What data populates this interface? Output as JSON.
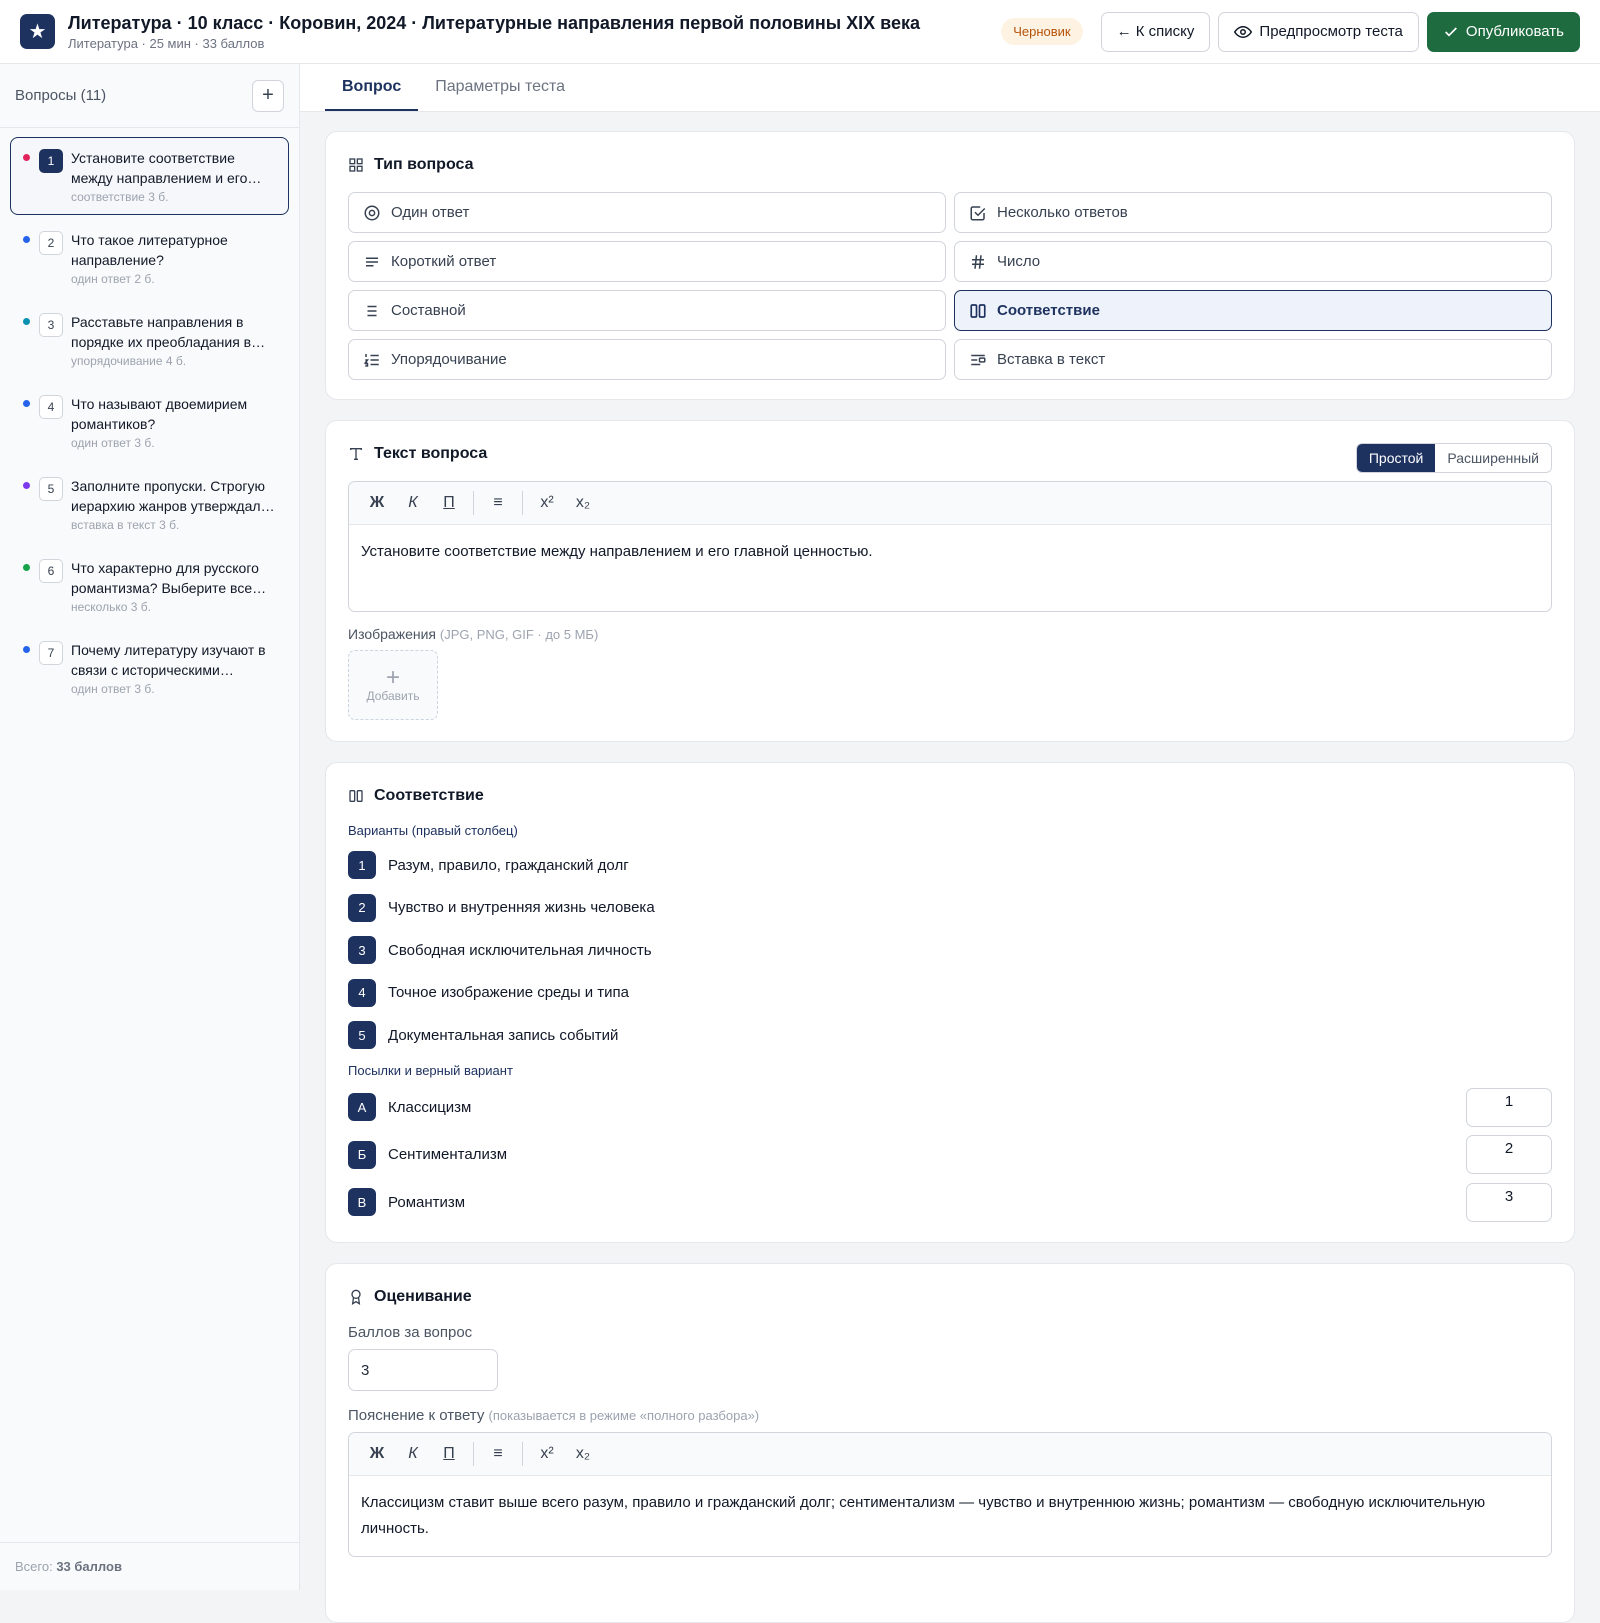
{
  "header": {
    "title": "Литература · 10 класс · Коровин, 2024 · Литературные направления первой половины XIX века",
    "subtitle": "Литература · 25 мин · 33 баллов",
    "status": "Черновик",
    "back_label": "← К списку",
    "preview_label": "Предпросмотр теста",
    "publish_label": "Опубликовать"
  },
  "sidebar": {
    "title": "Вопросы (11)",
    "add_label": "+",
    "total_prefix": "Всего:",
    "total_value": "33 баллов",
    "questions": [
      {
        "num": "1",
        "text": "Установите соответствие между направлением и его главной ценностью.",
        "type": "соответствие",
        "points": "3 б.",
        "color": "#e0245e"
      },
      {
        "num": "2",
        "text": "Что такое литературное направление?",
        "type": "один ответ",
        "points": "2 б.",
        "color": "#2563eb"
      },
      {
        "num": "3",
        "text": "Расставьте направления в порядке их преобладания в русской литературе.",
        "type": "упорядочивание",
        "points": "4 б.",
        "color": "#0891b2"
      },
      {
        "num": "4",
        "text": "Что называют двоемирием романтиков?",
        "type": "один ответ",
        "points": "3 б.",
        "color": "#2563eb"
      },
      {
        "num": "5",
        "text": "Заполните пропуски. Строгую иерархию жанров утверждал классицизм.",
        "type": "вставка в текст",
        "points": "3 б.",
        "color": "#7c3aed"
      },
      {
        "num": "6",
        "text": "Что характерно для русского романтизма? Выберите все верные ответы.",
        "type": "несколько",
        "points": "3 б.",
        "color": "#16a34a"
      },
      {
        "num": "7",
        "text": "Почему литературу изучают в связи с историческими событиями?",
        "type": "один ответ",
        "points": "3 б.",
        "color": "#2563eb"
      }
    ]
  },
  "tabs": [
    {
      "label": "Вопрос"
    },
    {
      "label": "Параметры теста"
    }
  ],
  "question_type": {
    "title": "Тип вопроса",
    "options": [
      {
        "label": "Один ответ",
        "icon": "radio-icon"
      },
      {
        "label": "Несколько ответов",
        "icon": "checkbox-icon"
      },
      {
        "label": "Короткий ответ",
        "icon": "short-text-icon"
      },
      {
        "label": "Число",
        "icon": "hash-icon"
      },
      {
        "label": "Составной",
        "icon": "list-icon"
      },
      {
        "label": "Соответствие",
        "icon": "columns-icon"
      },
      {
        "label": "Упорядочивание",
        "icon": "ordered-list-icon"
      },
      {
        "label": "Вставка в текст",
        "icon": "insert-text-icon"
      }
    ],
    "selected": "Соответствие"
  },
  "question_text": {
    "title": "Текст вопроса",
    "mode_simple": "Простой",
    "mode_advanced": "Расширенный",
    "toolbar": [
      "Ж",
      "К",
      "П",
      "≡",
      "x²",
      "x₂"
    ],
    "body": "Установите соответствие между направлением и его главной ценностью.",
    "images_label": "Изображения",
    "images_hint": "(JPG, PNG, GIF · до 5 МБ)",
    "add_image_label": "Добавить"
  },
  "matching": {
    "title": "Соответствие",
    "variants_label": "Варианты (правый столбец)",
    "variants": [
      {
        "num": "1",
        "text": "Разум, правило, гражданский долг"
      },
      {
        "num": "2",
        "text": "Чувство и внутренняя жизнь человека"
      },
      {
        "num": "3",
        "text": "Свободная исключительная личность"
      },
      {
        "num": "4",
        "text": "Точное изображение среды и типа"
      },
      {
        "num": "5",
        "text": "Документальная запись событий"
      }
    ],
    "premises_label": "Посылки и верный вариант",
    "premises": [
      {
        "letter": "А",
        "text": "Классицизм",
        "answer": "1"
      },
      {
        "letter": "Б",
        "text": "Сентиментализм",
        "answer": "2"
      },
      {
        "letter": "В",
        "text": "Романтизм",
        "answer": "3"
      }
    ]
  },
  "grading": {
    "title": "Оценивание",
    "points_label": "Баллов за вопрос",
    "points_value": "3",
    "explanation_label": "Пояснение к ответу",
    "explanation_hint": "(показывается в режиме «полного разбора»)",
    "toolbar": [
      "Ж",
      "К",
      "П",
      "≡",
      "x²",
      "x₂"
    ],
    "explanation": "Классицизм ставит выше всего разум, правило и гражданский долг; сентиментализм — чувство и внутреннюю жизнь; романтизм — свободную исключительную личность."
  },
  "colors": {
    "brand": "#1e3260",
    "publish": "#1d6b3f",
    "draft_bg": "#fef3e2",
    "draft_text": "#b45309"
  }
}
